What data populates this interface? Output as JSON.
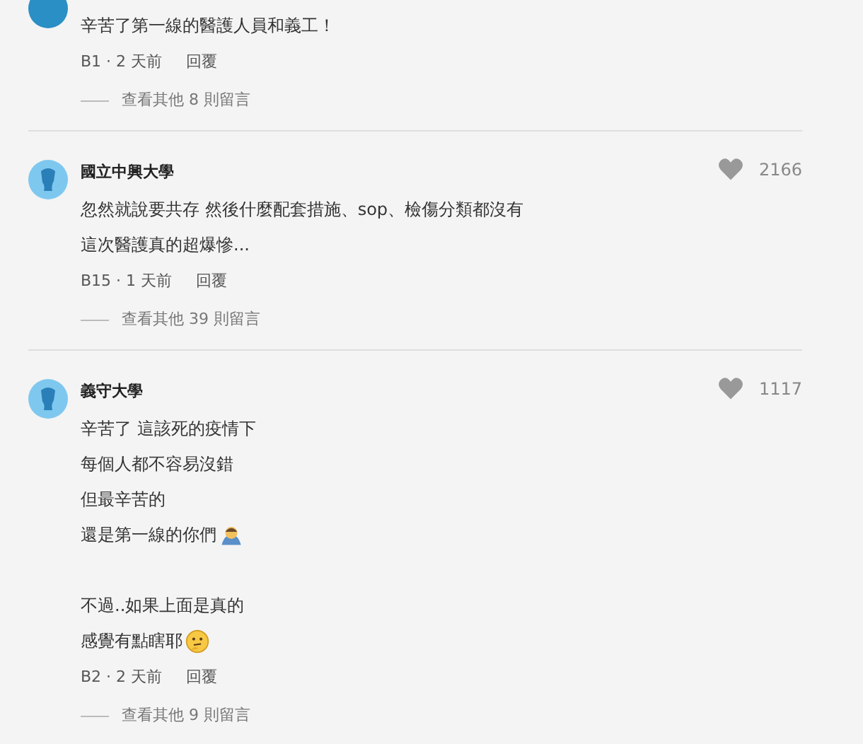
{
  "comments": [
    {
      "color": "#2a8fc4",
      "paragraphs": [
        [
          {
            "text": "辛苦了第一線的醫護人員和義工！",
            "kind": "plain"
          }
        ]
      ],
      "meta": "B1 · 2 天前",
      "reply": "回覆",
      "more_replies": "查看其他 8 則留言"
    },
    {
      "author": "國立中興大學",
      "color": "#7ec8ef",
      "likes": "2166",
      "paragraphs": [
        [
          {
            "text": "忽然就說要共存 然後什麼配套措施、sop、檢傷分類都沒有",
            "kind": "plain"
          },
          {
            "text": "這次醫護真的超爆慘...",
            "kind": "plain"
          }
        ]
      ],
      "meta": "B15 · 1 天前",
      "reply": "回覆",
      "more_replies": "查看其他 39 則留言"
    },
    {
      "author": "義守大學",
      "color": "#7ec8ef",
      "likes": "1117",
      "paragraphs": [
        [
          {
            "text": "辛苦了 這該死的疫情下",
            "kind": "plain"
          },
          {
            "text": "每個人都不容易沒錯",
            "kind": "plain"
          },
          {
            "text": "但最辛苦的",
            "kind": "plain"
          },
          {
            "text": "還是第一線的你們",
            "kind": "bowing"
          }
        ],
        [
          {
            "text": "不過..如果上面是真的",
            "kind": "plain"
          },
          {
            "text": "感覺有點瞎耶",
            "kind": "thinking"
          }
        ]
      ],
      "meta": "B2 · 2 天前",
      "reply": "回覆",
      "more_replies": "查看其他 9 則留言"
    }
  ]
}
